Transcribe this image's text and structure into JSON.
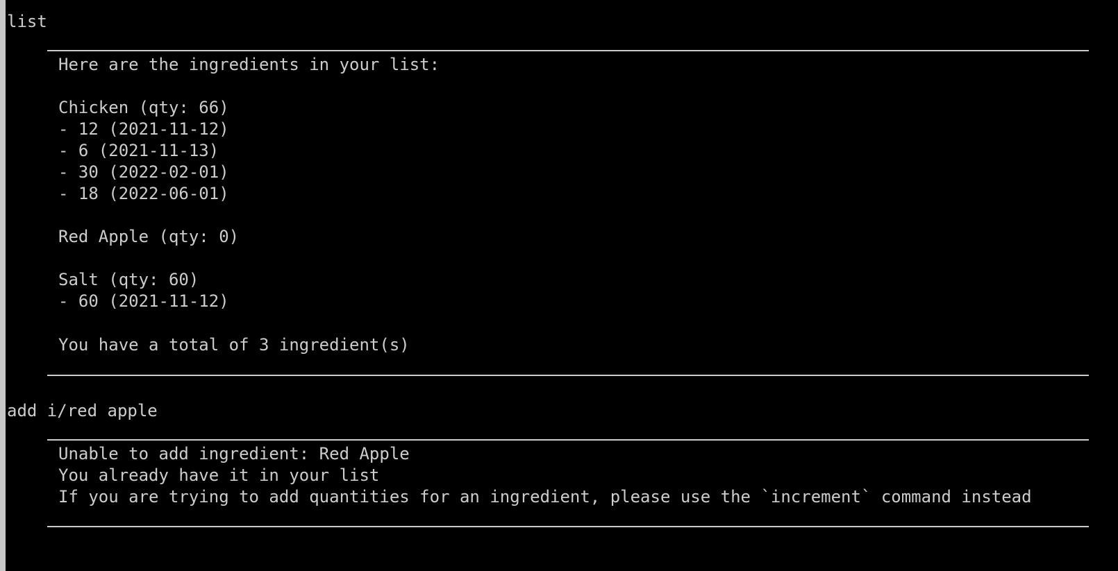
{
  "session": [
    {
      "command": "list",
      "response": [
        "Here are the ingredients in your list:",
        "",
        "Chicken (qty: 66)",
        "- 12 (2021-11-12)",
        "- 6 (2021-11-13)",
        "- 30 (2022-02-01)",
        "- 18 (2022-06-01)",
        "",
        "Red Apple (qty: 0)",
        "",
        "Salt (qty: 60)",
        "- 60 (2021-11-12)",
        "",
        "You have a total of 3 ingredient(s)"
      ]
    },
    {
      "command": "add i/red apple",
      "response": [
        "Unable to add ingredient: Red Apple",
        "You already have it in your list",
        "If you are trying to add quantities for an ingredient, please use the `increment` command instead"
      ]
    }
  ],
  "colors": {
    "background": "#000000",
    "foreground": "#cccccc",
    "window_edge": "#c8c8c8"
  }
}
